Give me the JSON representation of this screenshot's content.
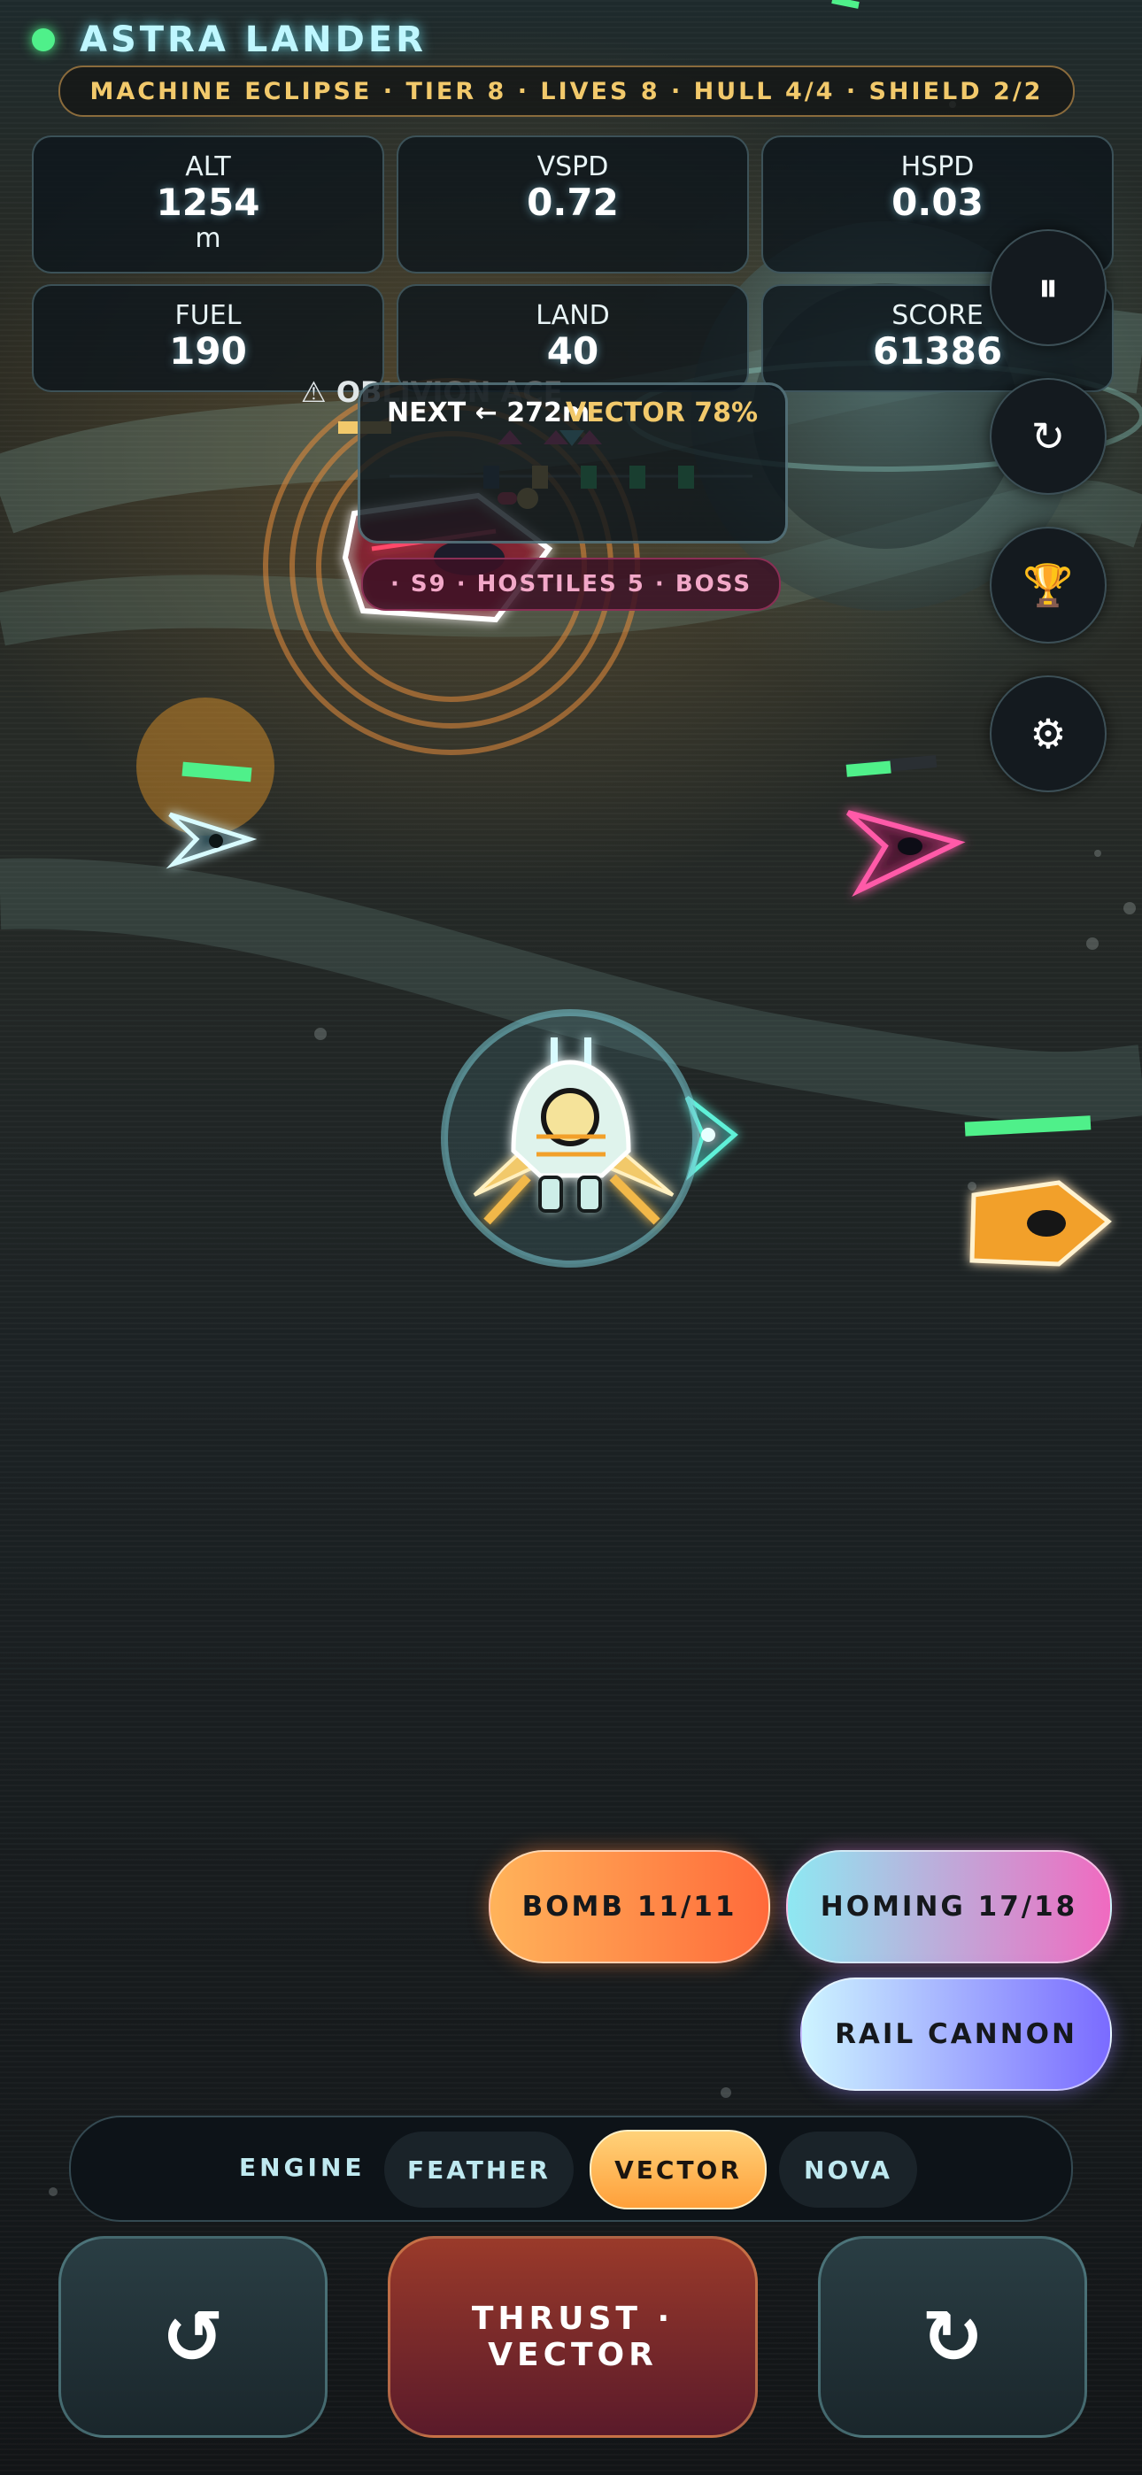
{
  "header": {
    "title": "ASTRA LANDER",
    "status_line": "MACHINE ECLIPSE · TIER 8 · LIVES 8 · HULL 4/4 · SHIELD 2/2"
  },
  "stats": {
    "alt": {
      "label": "ALT",
      "value": "1254",
      "unit": "m"
    },
    "vspd": {
      "label": "VSPD",
      "value": "0.72"
    },
    "hspd": {
      "label": "HSPD",
      "value": "0.03"
    },
    "fuel": {
      "label": "FUEL",
      "value": "190"
    },
    "land": {
      "label": "LAND",
      "value": "40"
    },
    "score": {
      "label": "SCORE",
      "value": "61386"
    }
  },
  "side_buttons": {
    "pause_icon": "⏸",
    "restart_icon": "↻",
    "trophy_icon": "🏆",
    "settings_icon": "⚙"
  },
  "threat": {
    "warning_icon": "⚠",
    "warning_visible": "OB",
    "warning_faded": "LIVION ACE",
    "next_text": "NEXT ← 272m",
    "vector_text": "VECTOR 78%",
    "sector_text": "· S9 · HOSTILES 5 · BOSS"
  },
  "weapons": {
    "bomb": "BOMB 11/11",
    "homing": "HOMING 17/18",
    "rail": "RAIL CANNON"
  },
  "engine": {
    "label": "ENGINE",
    "modes": [
      "FEATHER",
      "VECTOR",
      "NOVA"
    ],
    "selected": "VECTOR"
  },
  "controls": {
    "rotate_left_icon": "↺",
    "thrust_line1": "THRUST ·",
    "thrust_line2": "VECTOR",
    "rotate_right_icon": "↻"
  },
  "colors": {
    "accent_cyan": "#bff7ff",
    "gold": "#f2c96b",
    "life_green": "#4ff08a",
    "enemy_magenta": "#e23d86",
    "enemy_orange": "#f2a02a"
  }
}
